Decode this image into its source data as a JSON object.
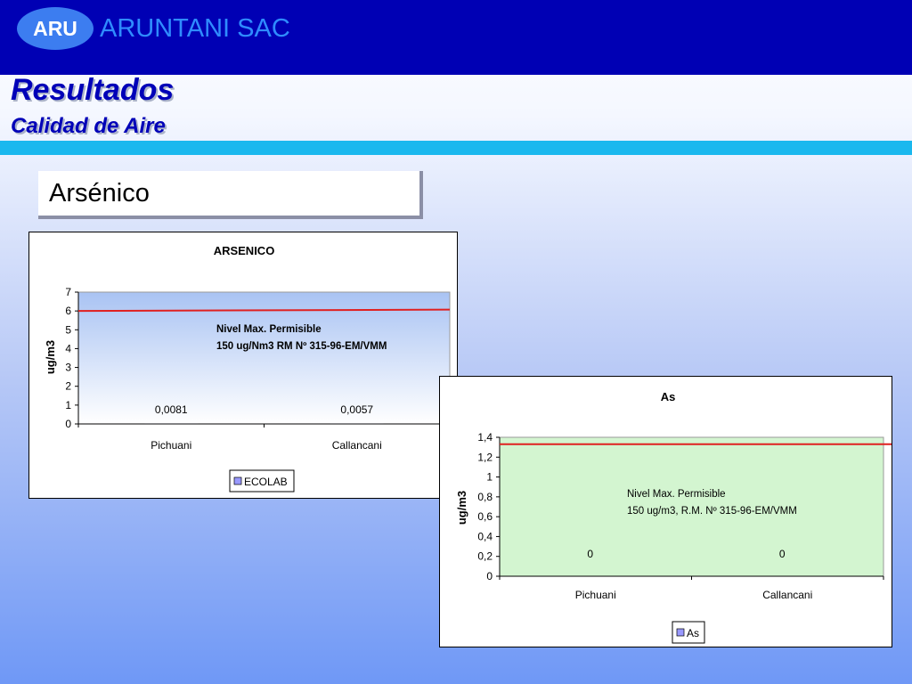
{
  "header": {
    "logo_text": "ARU",
    "company_name": "ARUNTANI SAC"
  },
  "title": "Resultados",
  "subtitle": "Calidad de Aire",
  "section_label": "Arsénico",
  "colors": {
    "header_bg": "#0000b4",
    "logo_bg": "#3c7df0",
    "company_text": "#2f8cff",
    "title_text": "#0000b8",
    "accent_bar": "#1ab8ee",
    "limit_line": "#e02020"
  },
  "chart_data": [
    {
      "type": "bar",
      "title": "ARSENICO",
      "ylabel": "ug/m3",
      "xlabel": "",
      "categories": [
        "Pichuani",
        "Callancani"
      ],
      "series": [
        {
          "name": "ECOLAB",
          "values": [
            0.0081,
            0.0057
          ]
        }
      ],
      "data_labels": [
        "0,0081",
        "0,0057"
      ],
      "ylim": [
        0,
        7
      ],
      "yticks": [
        "0",
        "1",
        "2",
        "3",
        "4",
        "5",
        "6",
        "7"
      ],
      "reference_line": 6,
      "annotation": [
        "Nivel Max. Permisible",
        "150 ug/Nm3 RM Nº 315-96-EM/VMM"
      ],
      "legend": "bottom",
      "plot_area_color": "#a9c3f3"
    },
    {
      "type": "bar",
      "title": "As",
      "ylabel": "ug/m3",
      "xlabel": "",
      "categories": [
        "Pichuani",
        "Callancani"
      ],
      "series": [
        {
          "name": "As",
          "values": [
            0,
            0
          ]
        }
      ],
      "data_labels": [
        "0",
        "0"
      ],
      "ylim": [
        0,
        1.4
      ],
      "yticks": [
        "0",
        "0,2",
        "0,4",
        "0,6",
        "0,8",
        "1",
        "1,2",
        "1,4"
      ],
      "reference_line": 1.33,
      "annotation": [
        "Nivel Max. Permisible",
        "150 ug/m3, R.M. Nº 315-96-EM/VMM"
      ],
      "legend": "bottom",
      "plot_area_color": "#d3f5d0"
    }
  ]
}
